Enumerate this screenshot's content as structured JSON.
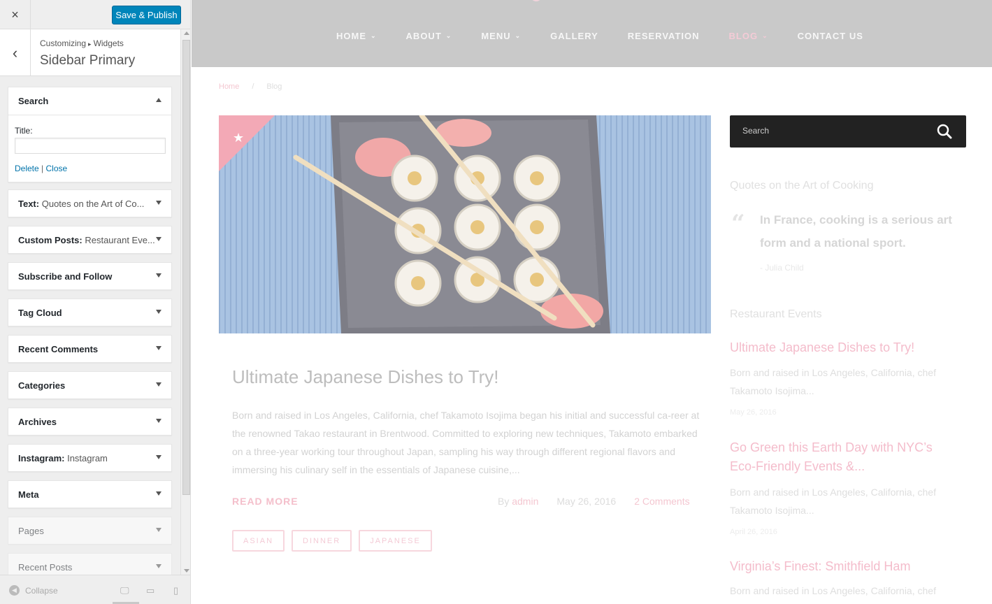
{
  "customizer": {
    "close_icon": "×",
    "save_label": "Save & Publish",
    "back_icon": "‹",
    "breadcrumb_parent": "Customizing",
    "breadcrumb_sep": "▸",
    "breadcrumb_child": "Widgets",
    "panel_title": "Sidebar Primary",
    "search_widget": {
      "title": "Search",
      "field_label": "Title:",
      "field_value": "",
      "delete_label": "Delete",
      "link_sep": "|",
      "close_label": "Close"
    },
    "widgets": [
      {
        "title": "Text:",
        "subtitle": " Quotes on the Art of Co..."
      },
      {
        "title": "Custom Posts:",
        "subtitle": " Restaurant Eve..."
      },
      {
        "title": "Subscribe and Follow",
        "subtitle": ""
      },
      {
        "title": "Tag Cloud",
        "subtitle": ""
      },
      {
        "title": "Recent Comments",
        "subtitle": ""
      },
      {
        "title": "Categories",
        "subtitle": ""
      },
      {
        "title": "Archives",
        "subtitle": ""
      },
      {
        "title": "Instagram:",
        "subtitle": " Instagram"
      },
      {
        "title": "Meta",
        "subtitle": ""
      },
      {
        "title": "Pages",
        "subtitle": ""
      },
      {
        "title": "Recent Posts",
        "subtitle": ""
      }
    ],
    "collapse_label": "Collapse",
    "collapse_icon": "◀",
    "device_icons": {
      "desktop": "🖵",
      "tablet": "▭",
      "mobile": "▯"
    }
  },
  "site": {
    "nav": [
      {
        "label": "HOME",
        "has_sub": true,
        "active": false
      },
      {
        "label": "ABOUT",
        "has_sub": true,
        "active": false
      },
      {
        "label": "MENU",
        "has_sub": true,
        "active": false
      },
      {
        "label": "GALLERY",
        "has_sub": false,
        "active": false
      },
      {
        "label": "RESERVATION",
        "has_sub": false,
        "active": false
      },
      {
        "label": "BLOG",
        "has_sub": true,
        "active": true
      },
      {
        "label": "CONTACT US",
        "has_sub": false,
        "active": false
      }
    ],
    "chevron": "⌄",
    "breadcrumb": {
      "home": "Home",
      "sep": "/",
      "current": "Blog"
    },
    "post": {
      "title": "Ultimate Japanese Dishes to Try!",
      "excerpt": "Born and raised in Los Angeles, California, chef Takamoto Isojima began his initial and successful ca-reer at the renowned Takao restaurant in Brentwood. Committed to exploring new techniques, Takamoto embarked on a three-year working tour throughout Japan, sampling his way through different regional flavors and immersing his culinary self in the essentials of Japanese cuisine,...",
      "read_more": "READ MORE",
      "by": "By",
      "author": "admin",
      "date": "May 26, 2016",
      "comments": "2 Comments",
      "tags": [
        "ASIAN",
        "DINNER",
        "JAPANESE"
      ]
    },
    "sidebar": {
      "search_placeholder": "Search",
      "quotes_heading": "Quotes on the Art of Cooking",
      "quote_mark": "“",
      "quote_text": "In France, cooking is a serious art form and a national sport.",
      "quote_author": "- Julia Child",
      "events_heading": "Restaurant Events",
      "events": [
        {
          "title": "Ultimate Japanese Dishes to Try!",
          "text": "Born and raised in Los Angeles, California, chef Takamoto Isojima...",
          "date": "May 26, 2016"
        },
        {
          "title": "Go Green this Earth Day with NYC’s Eco-Friendly Events &...",
          "text": "Born and raised in Los Angeles, California, chef Takamoto Isojima...",
          "date": "April 26, 2016"
        },
        {
          "title": "Virginia’s Finest: Smithfield Ham",
          "text": "Born and raised in Los Angeles, California, chef",
          "date": ""
        }
      ]
    }
  },
  "colors": {
    "save_button": "#0085ba",
    "accent_pink": "#f4bccb",
    "header_bg": "#c9c9c9",
    "search_bar": "#222222"
  }
}
